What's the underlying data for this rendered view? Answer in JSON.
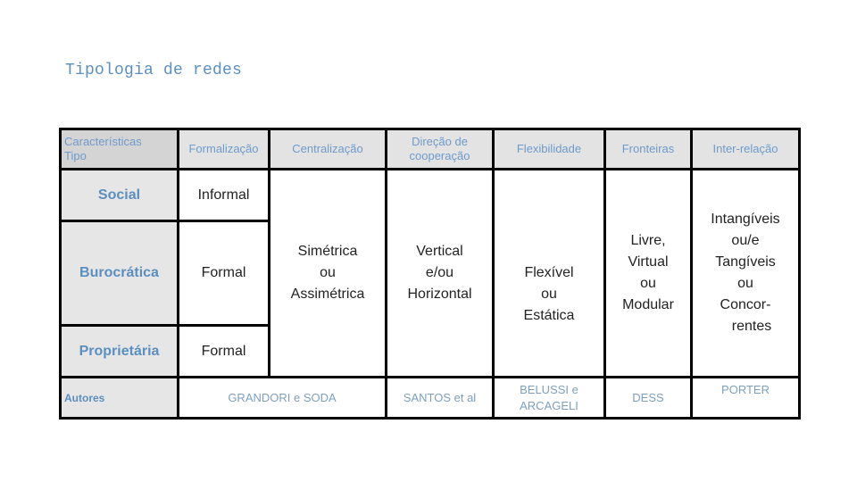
{
  "title": "Tipologia de redes",
  "table": {
    "header": {
      "corner_line1": "Características",
      "corner_line2": "Tipo",
      "columns": [
        "Formalização",
        "Centralização",
        "Direção de cooperação",
        "Flexibilidade",
        "Fronteiras",
        "Inter-relação"
      ]
    },
    "rows": [
      {
        "type": "Social",
        "formalizacao": "Informal"
      },
      {
        "type": "Burocrática",
        "formalizacao": "Formal"
      },
      {
        "type": "Proprietária",
        "formalizacao": "Formal"
      }
    ],
    "shared": {
      "centralizacao": [
        "Simétrica",
        "ou",
        "Assimétrica"
      ],
      "direcao": [
        "Vertical",
        "e/ou",
        "Horizontal"
      ],
      "flexibilidade": [
        "Flexível",
        "ou",
        "Estática"
      ],
      "fronteiras": [
        "Livre,",
        "Virtual",
        "ou",
        "Modular"
      ],
      "interrelacao": [
        "Intangíveis",
        "ou/e",
        "Tangíveis",
        "ou",
        "Concor-",
        "rentes"
      ]
    },
    "authors": {
      "label": "Autores",
      "formalizacao_centralizacao": "GRANDORI e SODA",
      "direcao": "SANTOS et al",
      "flexibilidade_line1": "BELUSSI e",
      "flexibilidade_line2": "ARCAGELI",
      "fronteiras": "DESS",
      "interrelacao": "PORTER"
    }
  }
}
